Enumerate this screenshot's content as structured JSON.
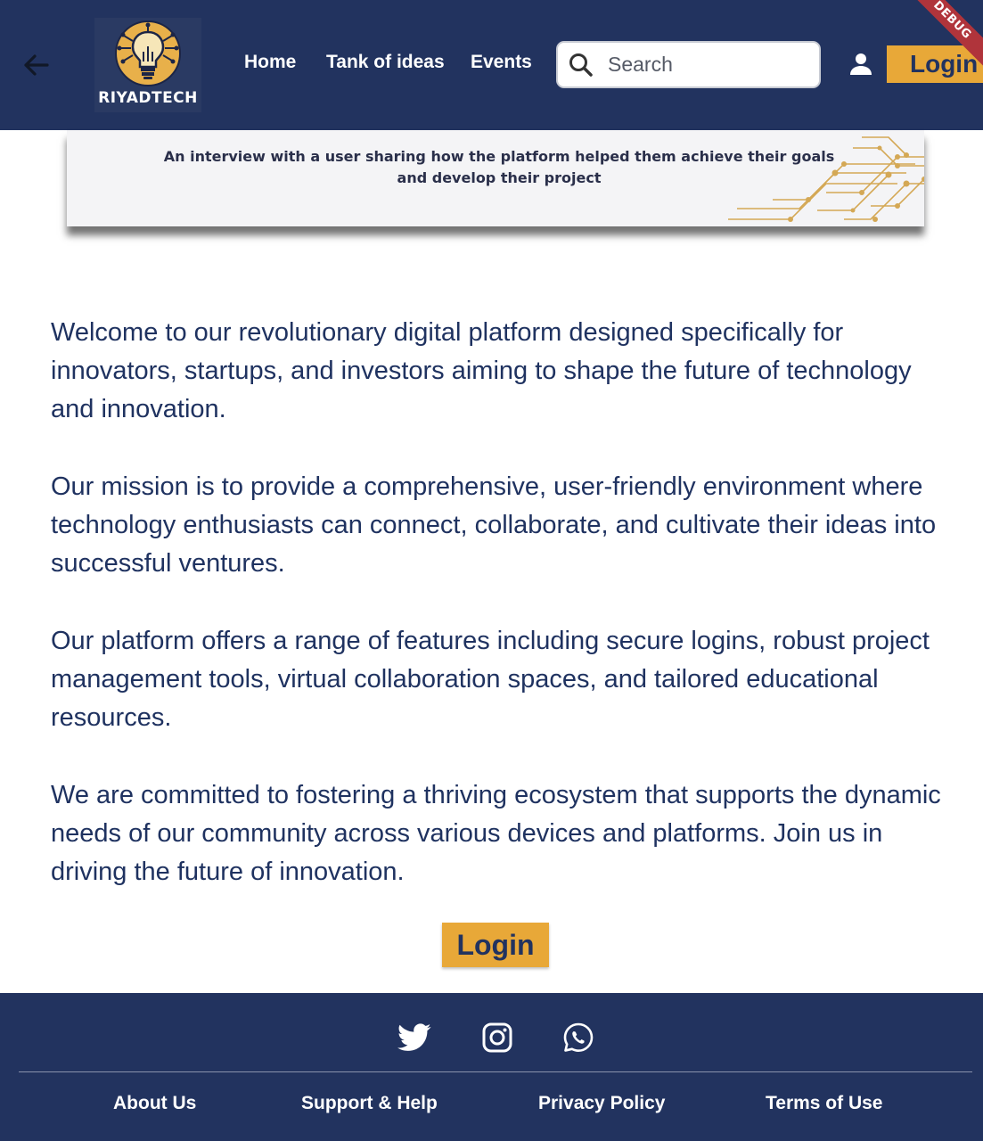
{
  "header": {
    "logo_text": "RIYADTECH",
    "nav": {
      "home": "Home",
      "tank_of_ideas": "Tank of ideas",
      "events": "Events"
    },
    "search": {
      "placeholder": "Search",
      "value": ""
    },
    "login_label": "Login",
    "debug_label": "DEBUG"
  },
  "banner": {
    "caption": "An interview with a user sharing how the platform helped them achieve their goals and develop their project"
  },
  "content": {
    "paragraphs": [
      "Welcome to our revolutionary digital platform designed specifically for innovators, startups, and investors aiming to shape the future of technology and innovation.",
      "Our mission is to provide a comprehensive, user-friendly environment where technology enthusiasts can connect, collaborate, and cultivate their ideas into successful ventures.",
      "Our platform offers a range of features including secure logins, robust project management tools, virtual collaboration spaces, and tailored educational resources.",
      "We are committed to fostering a thriving ecosystem that supports the dynamic needs of our community across various devices and platforms. Join us in driving the future of innovation."
    ],
    "login_label": "Login"
  },
  "footer": {
    "social": [
      "twitter-icon",
      "instagram-icon",
      "whatsapp-icon"
    ],
    "links": {
      "about": "About Us",
      "support": "Support & Help",
      "privacy": "Privacy Policy",
      "terms": "Terms of Use"
    }
  },
  "colors": {
    "navy": "#22335f",
    "accent": "#e8a838",
    "text": "#1f3260"
  }
}
